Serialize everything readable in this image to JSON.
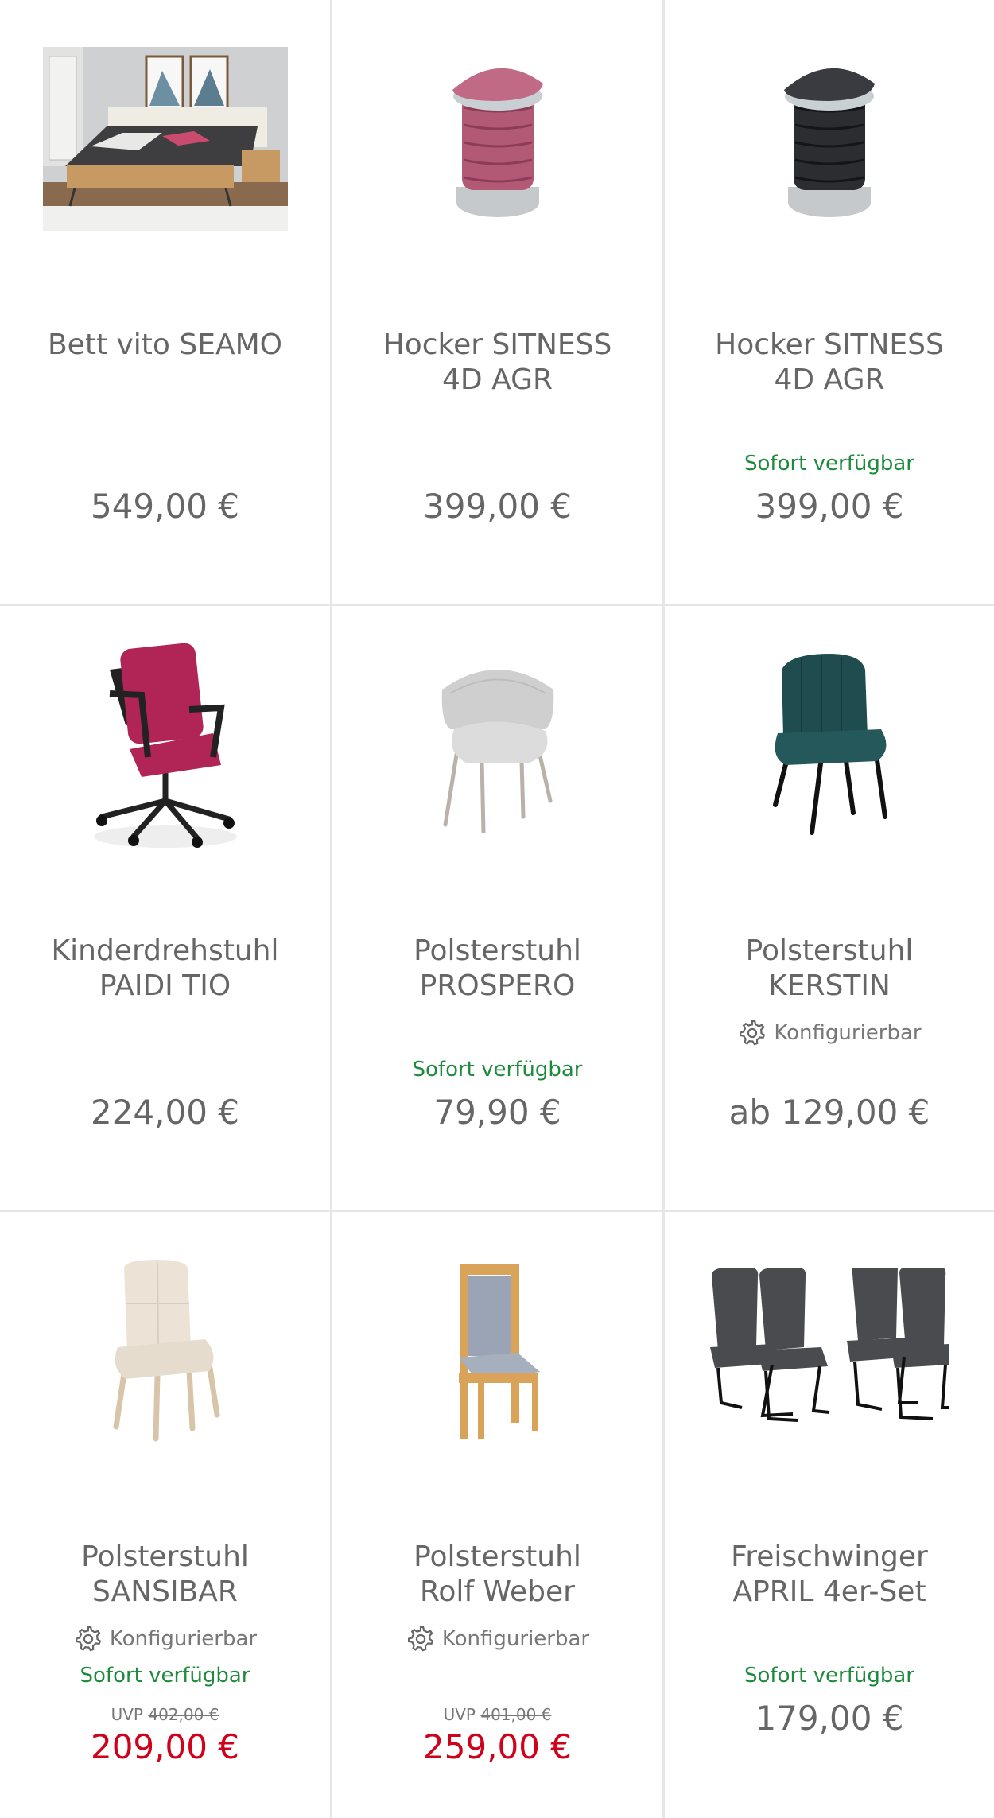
{
  "colors": {
    "availability_green": "#1e8a3c",
    "sale_red": "#d0021b",
    "text_gray": "#666666",
    "divider": "#e6e6e6"
  },
  "products": [
    {
      "title_line1": "Bett vito SEAMO",
      "title_line2": "",
      "price": "549,00 €",
      "image": "bed-photo"
    },
    {
      "title_line1": "Hocker SITNESS",
      "title_line2": "4D AGR",
      "price": "399,00 €",
      "image": "pink-stool"
    },
    {
      "title_line1": "Hocker SITNESS",
      "title_line2": "4D AGR",
      "availability": "Sofort verfügbar",
      "price": "399,00 €",
      "image": "black-stool"
    },
    {
      "title_line1": "Kinderdrehstuhl",
      "title_line2": "PAIDI TIO",
      "price": "224,00 €",
      "image": "pink-office-chair"
    },
    {
      "title_line1": "Polsterstuhl",
      "title_line2": "PROSPERO",
      "availability": "Sofort verfügbar",
      "price": "79,90 €",
      "image": "gray-armchair"
    },
    {
      "title_line1": "Polsterstuhl",
      "title_line2": "KERSTIN",
      "configurable": "Konfigurierbar",
      "price": "ab 129,00 €",
      "image": "green-chair"
    },
    {
      "title_line1": "Polsterstuhl",
      "title_line2": "SANSIBAR",
      "configurable": "Konfigurierbar",
      "availability": "Sofort verfügbar",
      "uvp_label": "UVP",
      "uvp_price": "402,00 €",
      "price": "209,00 €",
      "image": "beige-chair"
    },
    {
      "title_line1": "Polsterstuhl",
      "title_line2": "Rolf Weber",
      "configurable": "Konfigurierbar",
      "uvp_label": "UVP",
      "uvp_price": "401,00 €",
      "price": "259,00 €",
      "image": "wood-chair"
    },
    {
      "title_line1": "Freischwinger",
      "title_line2": "APRIL 4er-Set",
      "availability": "Sofort verfügbar",
      "price": "179,00 €",
      "image": "cantilever-chairs-set"
    }
  ]
}
